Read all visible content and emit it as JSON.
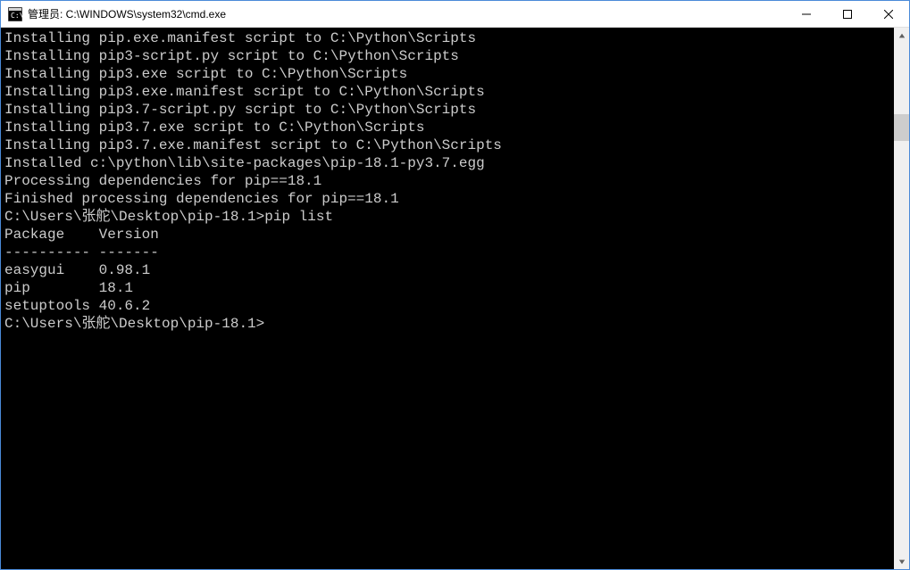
{
  "titlebar": {
    "title": "管理员: C:\\WINDOWS\\system32\\cmd.exe"
  },
  "console": {
    "lines": [
      "Installing pip.exe.manifest script to C:\\Python\\Scripts",
      "Installing pip3-script.py script to C:\\Python\\Scripts",
      "Installing pip3.exe script to C:\\Python\\Scripts",
      "Installing pip3.exe.manifest script to C:\\Python\\Scripts",
      "Installing pip3.7-script.py script to C:\\Python\\Scripts",
      "Installing pip3.7.exe script to C:\\Python\\Scripts",
      "Installing pip3.7.exe.manifest script to C:\\Python\\Scripts",
      "",
      "Installed c:\\python\\lib\\site-packages\\pip-18.1-py3.7.egg",
      "Processing dependencies for pip==18.1",
      "Finished processing dependencies for pip==18.1",
      "",
      "C:\\Users\\张舵\\Desktop\\pip-18.1>pip list",
      "Package    Version",
      "---------- -------",
      "easygui    0.98.1",
      "pip        18.1",
      "setuptools 40.6.2",
      "",
      "C:\\Users\\张舵\\Desktop\\pip-18.1>"
    ]
  },
  "scrollbar": {
    "thumbTop": "80px",
    "thumbHeight": "30px"
  }
}
